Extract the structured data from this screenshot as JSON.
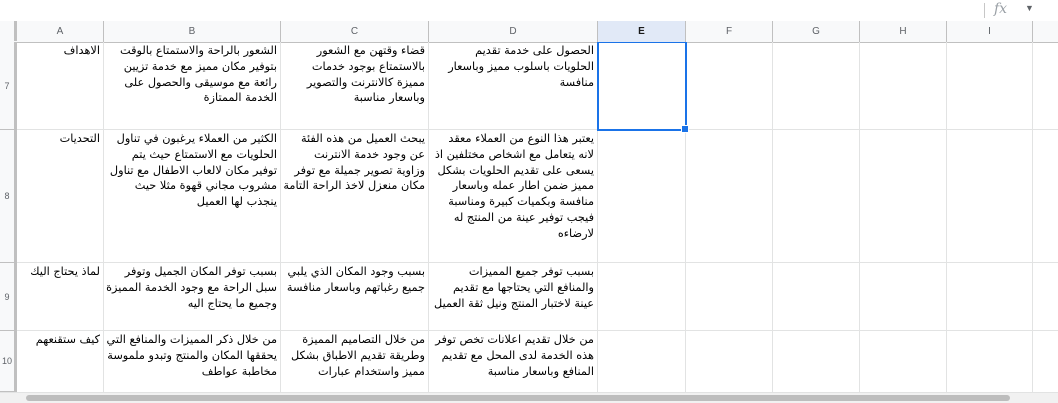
{
  "toolbar": {
    "fx_label": "fx",
    "dropdown_icon": "chevron-down-icon"
  },
  "columns": [
    "A",
    "B",
    "C",
    "D",
    "E",
    "F",
    "G",
    "H",
    "I"
  ],
  "selected_cell": "E7",
  "rows": [
    {
      "number": "7",
      "cells": {
        "A": "الاهداف",
        "B": "الشعور بالراحة والاستمتاع بالوقت بتوفير مكان مميز مع خدمة تزيين رائعة مع موسيقى والحصول على الخدمة الممتازة",
        "C": "قضاء وقتهن مع الشعور بالاستمتاع بوجود خدمات مميزة كالانترنت والتصوير وباسعار مناسبة",
        "D": "الحصول على خدمة تقديم الحلويات باسلوب مميز وباسعار منافسة"
      }
    },
    {
      "number": "8",
      "cells": {
        "A": "التحديات",
        "B": "الكثير من العملاء يرغبون في تناول الحلويات مع الاستمتاع حيث يتم توفير مكان لالعاب الاطفال مع تناول مشروب مجاني قهوة مثلا حيث ينجذب لها العميل",
        "C": "يبحث العميل من هذه الفئة عن وجود خدمة الانترنت وزاوية تصوير جميلة مع توفر مكان منعزل لاخذ الراحة التامة",
        "D": "يعتبر هذا النوع من العملاء معقد لانه يتعامل مع اشخاص مختلفين اذ يسعى على تقديم الحلويات بشكل مميز ضمن اطار عمله وباسعار منافسة وبكميات كبيرة ومناسبة فيجب توفير عينة من المنتج له لارضاءه"
      }
    },
    {
      "number": "9",
      "cells": {
        "A": "لماذ يحتاج اليك",
        "B": "بسبب توفر المكان الجميل وتوفر سبل الراحة مع وجود الخدمة المميزة وجميع ما يحتاج اليه",
        "C": "بسبب وجود المكان الذي يلبي جميع رغباتهم وباسعار منافسة",
        "D": "بسبب توفر جميع المميزات والمنافع التي يحتاجها مع تقديم عينة لاختبار المنتج ونيل ثقة العميل"
      }
    },
    {
      "number": "10",
      "cells": {
        "A": "كيف ستقنعهم",
        "B": "من خلال ذكر المميزات والمنافع التي يحققها المكان والمنتج وتبدو ملموسة مخاطبة عواطف",
        "C": "من خلال التصاميم المميزة وطريقة تقديم الاطباق بشكل مميز واستخدام عبارات",
        "D": "من خلال تقديم اعلانات تخص توفر هذه الخدمة لدى المحل مع تقديم المنافع وباسعار مناسبة"
      }
    }
  ]
}
